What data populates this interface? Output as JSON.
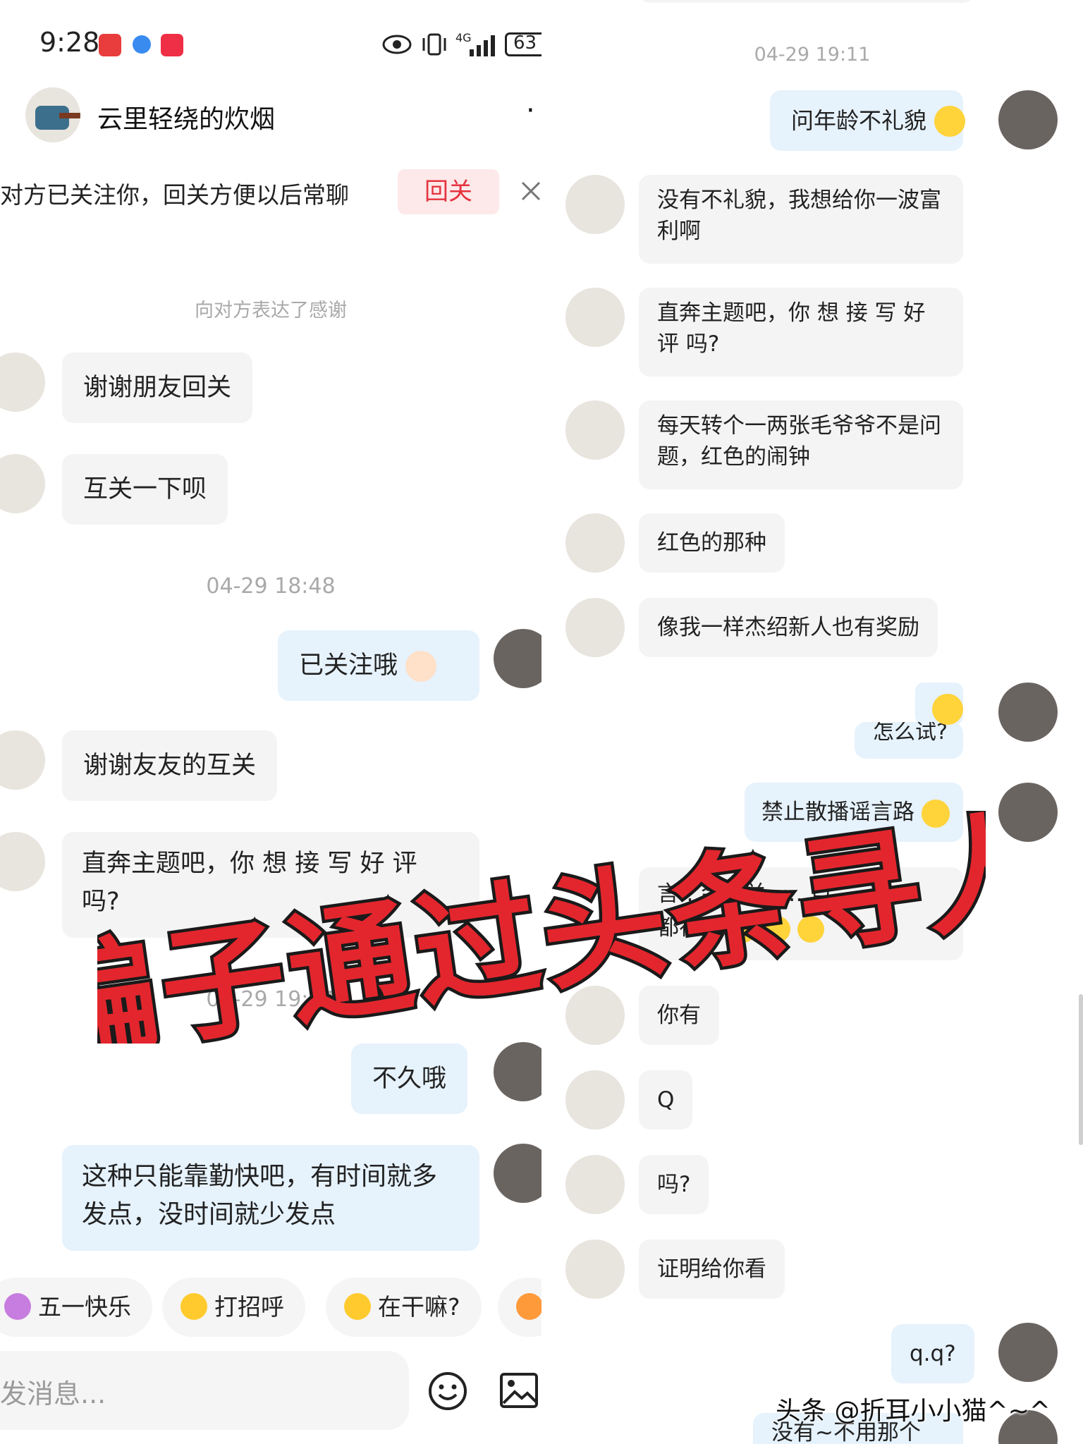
{
  "status_bar": {
    "time": "9:28",
    "network": "4G",
    "battery": "63"
  },
  "header": {
    "contact_name": "云里轻绕的炊烟",
    "more": "·"
  },
  "follow_banner": {
    "text": "对方已关注你，回关方便以后常聊",
    "button": "回关"
  },
  "left_messages": {
    "system_note": "向对方表达了感谢",
    "m1": "谢谢朋友回关",
    "m2": "互关一下呗",
    "ts1": "04-29 18:48",
    "m3": "已关注哦",
    "m4": "谢谢友友的互关",
    "m5": "直奔主题吧，你 想 接 写 好 评 吗?",
    "ts2": "04-29 19:04",
    "m6": "不久哦",
    "m7": "这种只能靠勤快吧，有时间就多发点，没时间就少发点"
  },
  "quick_replies": [
    "五一快乐",
    "打招呼",
    "在干嘛?"
  ],
  "composer": {
    "placeholder": "发消息..."
  },
  "right_messages": {
    "ts": "04-29 19:11",
    "r1": "问年龄不礼貌",
    "r2": "没有不礼貌，我想给你一波富利啊",
    "r3": "直奔主题吧，你 想 接 写 好 评 吗?",
    "r4": "每天转个一两张毛爷爷不是问题，红色的闹钟",
    "r5": "红色的那种",
    "r6": "像我一样杰绍新人也有奖励",
    "r7": "怎么试?",
    "r8": "禁止散播谣言路",
    "r9a": "言…会…关，…自",
    "r9b": "都在做",
    "r10": "你有",
    "r11": "Q",
    "r12": "吗?",
    "r13": "证明给你看",
    "r14": "q.q?",
    "r15": "没有~不用那个"
  },
  "overlay_title": "骗子通过头条寻人",
  "watermark": "头条 @折耳小小猫^~^",
  "colors": {
    "banner_button": "#e5333f",
    "overlay_red": "#e3262d",
    "out_bubble": "#e6f2fc",
    "in_bubble": "#f4f4f4"
  }
}
